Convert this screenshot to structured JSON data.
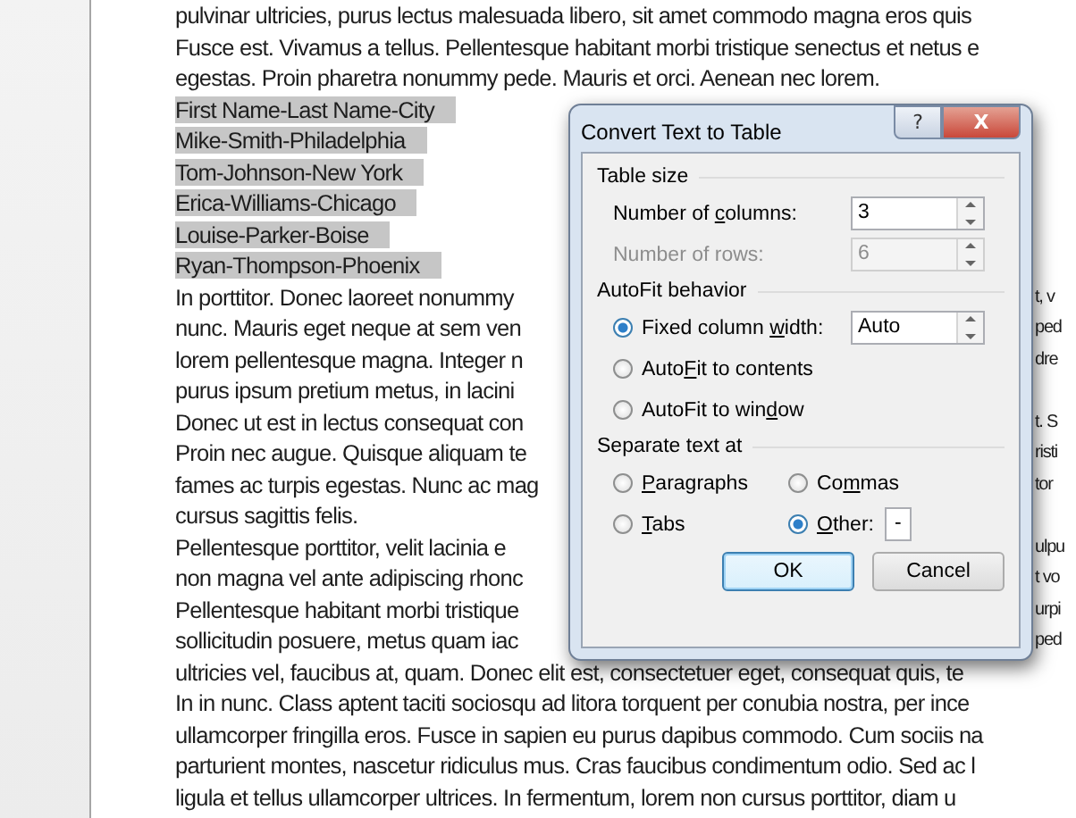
{
  "document": {
    "lines": [
      {
        "text": "pulvinar ultricies, purus lectus malesuada libero, sit amet commodo magna eros quis",
        "highlighted": false
      },
      {
        "text": "Fusce est. Vivamus a tellus. Pellentesque habitant morbi tristique senectus et netus e",
        "highlighted": false
      },
      {
        "text": "egestas. Proin pharetra nonummy pede. Mauris et orci. Aenean nec lorem.",
        "highlighted": false
      },
      {
        "text": "First Name-Last Name-City",
        "highlighted": true
      },
      {
        "text": "Mike-Smith-Philadelphia",
        "highlighted": true
      },
      {
        "text": "Tom-Johnson-New York",
        "highlighted": true
      },
      {
        "text": "Erica-Williams-Chicago",
        "highlighted": true
      },
      {
        "text": "Louise-Parker-Boise",
        "highlighted": true
      },
      {
        "text": "Ryan-Thompson-Phoenix",
        "highlighted": true
      },
      {
        "text": "In porttitor. Donec laoreet nonummy",
        "right": "t, v",
        "highlighted": false
      },
      {
        "text": "nunc. Mauris eget neque at sem ven",
        "right": "ped",
        "highlighted": false
      },
      {
        "text": "lorem pellentesque magna. Integer n",
        "right": "dre",
        "highlighted": false
      },
      {
        "text": "purus ipsum pretium metus, in lacini",
        "highlighted": false
      },
      {
        "text": "Donec ut est in lectus consequat con",
        "right": "t. S",
        "highlighted": false
      },
      {
        "text": "Proin nec augue. Quisque aliquam te",
        "right": "risti",
        "highlighted": false
      },
      {
        "text": "fames ac turpis egestas. Nunc ac mag",
        "right": "tor",
        "highlighted": false
      },
      {
        "text": "cursus sagittis felis.",
        "highlighted": false
      },
      {
        "text": "Pellentesque porttitor, velit lacinia e",
        "right": "ulpu",
        "highlighted": false
      },
      {
        "text": "non magna vel ante adipiscing rhonc",
        "right": "t vo",
        "highlighted": false
      },
      {
        "text": "Pellentesque habitant morbi tristique",
        "right": "urpi",
        "highlighted": false
      },
      {
        "text": "sollicitudin posuere, metus quam iac",
        "right": "ped",
        "highlighted": false
      },
      {
        "text": "ultricies vel, faucibus at, quam. Donec elit est, consectetuer eget, consequat quis, te",
        "highlighted": false
      },
      {
        "text": "In in nunc. Class aptent taciti sociosqu ad litora torquent per conubia nostra, per ince",
        "highlighted": false
      },
      {
        "text": "ullamcorper fringilla eros. Fusce in sapien eu purus dapibus commodo. Cum sociis na",
        "highlighted": false
      },
      {
        "text": "parturient montes, nascetur ridiculus mus. Cras faucibus condimentum odio. Sed ac l",
        "highlighted": false
      },
      {
        "text": "ligula et tellus ullamcorper ultrices. In fermentum, lorem non cursus porttitor, diam u",
        "highlighted": false
      }
    ]
  },
  "dialog": {
    "title": "Convert Text to Table",
    "help": "?",
    "close": "X",
    "sections": [
      {
        "heading": "Table size",
        "rows": [
          {
            "kind": "spin",
            "label": {
              "pre": "Number of ",
              "key": "c",
              "post": "olumns:"
            },
            "value": "3",
            "disabled": false
          },
          {
            "kind": "spin",
            "label": {
              "pre": "Number of rows:"
            },
            "value": "6",
            "disabled": true
          }
        ]
      },
      {
        "heading": "AutoFit behavior",
        "rows": [
          {
            "kind": "radio-spin",
            "label": {
              "pre": "Fixed column ",
              "key": "w",
              "post": "idth:"
            },
            "value": "Auto",
            "selected": true
          },
          {
            "kind": "radio",
            "label": {
              "pre": "Auto",
              "key": "F",
              "post": "it to contents"
            },
            "selected": false
          },
          {
            "kind": "radio",
            "label": {
              "pre": "AutoFit to win",
              "key": "d",
              "post": "ow"
            },
            "selected": false
          }
        ]
      },
      {
        "heading": "Separate text at",
        "rows": [
          {
            "kind": "radio-pair",
            "items": [
              {
                "label": {
                  "key": "P",
                  "post": "aragraphs"
                },
                "selected": false
              },
              {
                "label": {
                  "pre": "Co",
                  "key": "m",
                  "post": "mas"
                },
                "selected": false
              }
            ]
          },
          {
            "kind": "radio-pair",
            "items": [
              {
                "label": {
                  "key": "T",
                  "post": "abs"
                },
                "selected": false
              },
              {
                "label": {
                  "key": "O",
                  "post": "ther:"
                },
                "selected": true,
                "value": "-"
              }
            ]
          }
        ]
      }
    ],
    "buttons": [
      {
        "label": "OK",
        "default": true
      },
      {
        "label": "Cancel",
        "default": false
      }
    ]
  }
}
